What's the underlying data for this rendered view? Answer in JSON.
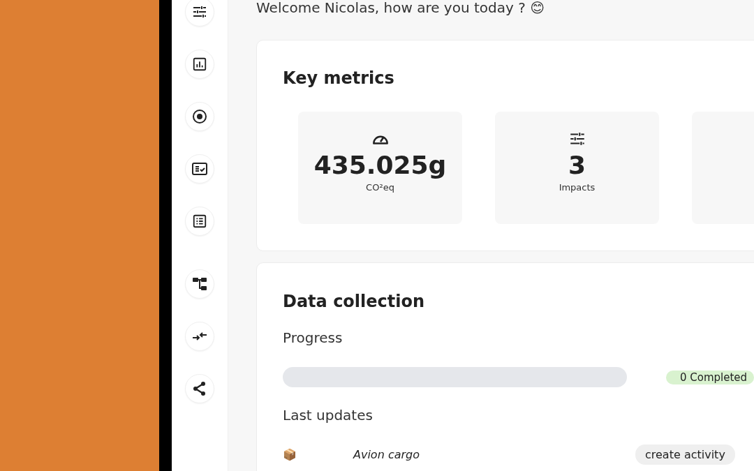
{
  "welcome": "Welcome Nicolas, how are you today ? 😊",
  "key_metrics": {
    "title": "Key metrics",
    "metrics": [
      {
        "kind": "gauge",
        "value": "435.025g",
        "unit": "CO²eq"
      },
      {
        "kind": "sliders",
        "value": "3",
        "unit": "Impacts"
      }
    ]
  },
  "data_collection": {
    "title": "Data collection",
    "progress_label": "Progress",
    "progress": {
      "level": 0,
      "badge": "0 Completed"
    },
    "updates_label": "Last updates",
    "updates": [
      {
        "icon": "📦",
        "name": "Avion cargo",
        "action": "create activity"
      }
    ]
  }
}
